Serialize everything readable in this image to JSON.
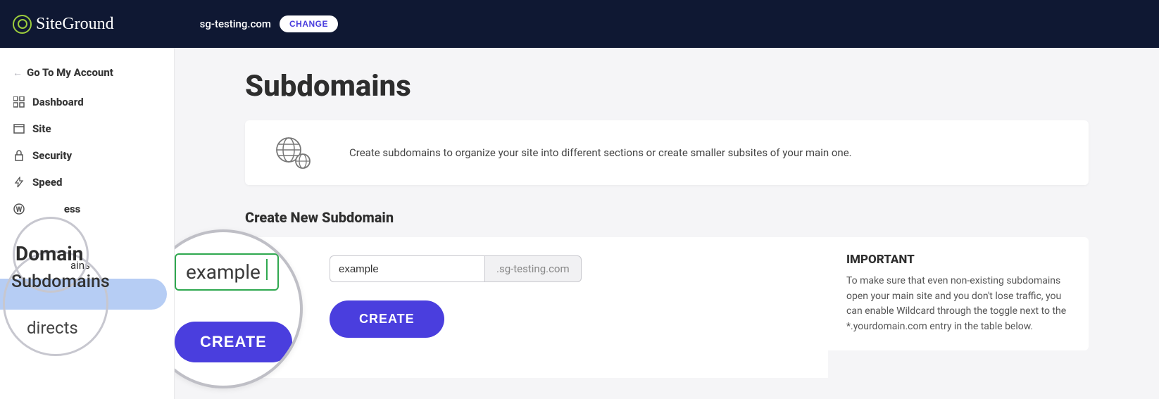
{
  "brand": "SiteGround",
  "header": {
    "domain": "sg-testing.com",
    "change_label": "CHANGE"
  },
  "sidebar": {
    "back_label": "Go To My Account",
    "items": [
      {
        "label": "Dashboard"
      },
      {
        "label": "Site"
      },
      {
        "label": "Security"
      },
      {
        "label": "Speed"
      },
      {
        "label": "WordPress"
      },
      {
        "label": "Domain"
      }
    ],
    "domain_sub": [
      {
        "label": "Parked Domains"
      },
      {
        "label": "Subdomains"
      },
      {
        "label": "Redirects"
      }
    ],
    "zoom_labels": {
      "domain": "Domain",
      "subdomains": "Subdomains",
      "redirects": "directs"
    }
  },
  "main": {
    "title": "Subdomains",
    "intro": "Create subdomains to organize your site into different sections or create smaller subsites of your main one.",
    "create_heading": "Create New Subdomain",
    "input_value": "example",
    "input_suffix": ".sg-testing.com",
    "create_button": "CREATE",
    "important": {
      "title": "IMPORTANT",
      "text": "To make sure that even non-existing subdomains open your main site and you don't lose traffic, you can enable Wildcard through the toggle next to the *.yourdomain.com entry in the table below."
    }
  }
}
